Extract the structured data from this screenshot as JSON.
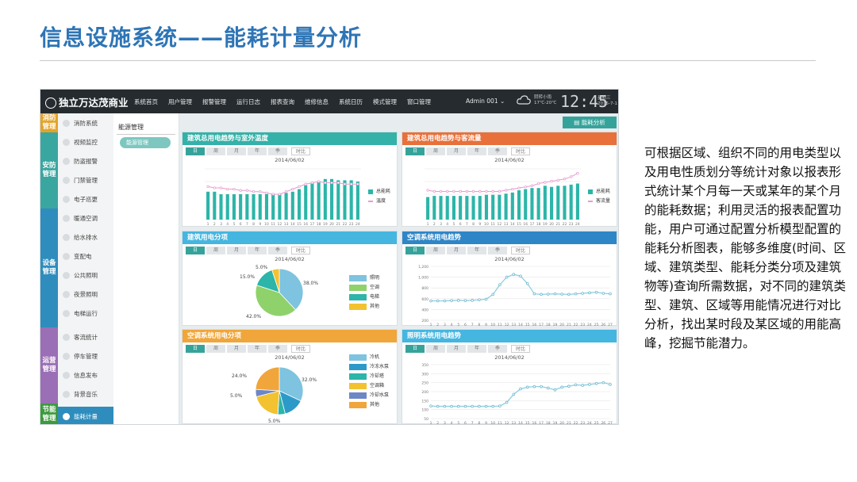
{
  "slide": {
    "title": "信息设施系统——能耗计量分析",
    "description": "可根据区域、组织不同的用电类型以及用电性质划分等统计对象以报表形式统计某个月每一天或某年的某个月的能耗数据；利用灵活的报表配置功能，用户可通过配置分析模型配置的能耗分析图表，能够多维度(时间、区域、建筑类型、能耗分类分项及建筑物等)查询所需数据，对不同的建筑类型、建筑、区域等用能情况进行对比分析，找出某时段及某区域的用能高峰，挖掘节能潜力。"
  },
  "app": {
    "logo_text": "独立万达茂商业",
    "nav": [
      "系统首页",
      "用户管理",
      "报警管理",
      "运行日志",
      "报表查询",
      "维修信息",
      "系统日历",
      "模式管理",
      "窗口管理"
    ],
    "admin": "Admin 001",
    "weather": [
      "阴转小雨",
      "17℃-20℃"
    ],
    "clock": "12:45",
    "date": [
      "星期三",
      "2015-7-1"
    ],
    "top_button": "能耗分析",
    "sub_title": "能源管理",
    "sub_item": "能源管理",
    "groups": [
      {
        "label": "消防管理",
        "color": "#e3a32a"
      },
      {
        "label": "安防管理",
        "color": "#3aa6a0"
      },
      {
        "label": "设备管理",
        "color": "#2f8dbd"
      },
      {
        "label": "运营管理",
        "color": "#9b6fb5"
      },
      {
        "label": "节能管理",
        "color": "#3d9a3d"
      }
    ],
    "menu": [
      "消防系统",
      "视频监控",
      "防盗报警",
      "门禁管理",
      "电子巡更",
      "暖通空调",
      "给水排水",
      "变配电",
      "公共照明",
      "夜景照明",
      "电梯运行",
      "客流统计",
      "停车管理",
      "信息发布",
      "背景音乐",
      "能耗计量"
    ]
  },
  "tabs": [
    "日",
    "周",
    "月",
    "年",
    "季",
    "时比"
  ],
  "panels": [
    {
      "title": "建筑总用电趋势与室外温度",
      "color": "#34b1a8",
      "date": "2014/06/02",
      "legend": [
        "总能耗",
        "温度"
      ],
      "series_colors": [
        "#2cb5a8",
        "#e89ad0"
      ]
    },
    {
      "title": "建筑总用电趋势与客流量",
      "color": "#e8703a",
      "date": "2014/06/02",
      "legend": [
        "总能耗",
        "客流量"
      ],
      "series_colors": [
        "#2cb5a8",
        "#e89ad0"
      ]
    },
    {
      "title": "建筑用电分项",
      "color": "#45b6e0",
      "date": "2014/06/02",
      "legend": [
        "照明",
        "空调",
        "电梯",
        "其他"
      ]
    },
    {
      "title": "空调系统用电趋势",
      "color": "#2f86c7",
      "date": "2014/06/02"
    },
    {
      "title": "空调系统用电分项",
      "color": "#f0a63a",
      "date": "2014/06/02",
      "legend": [
        "冷机",
        "冷冻水泵",
        "冷却塔",
        "空调箱",
        "冷却水泵",
        "其他"
      ]
    },
    {
      "title": "照明系统用电趋势",
      "color": "#45b6e0",
      "date": "2014/06/02"
    }
  ],
  "chart_data": [
    {
      "type": "bar",
      "title": "建筑总用电趋势与室外温度",
      "categories": [
        "1",
        "2",
        "3",
        "4",
        "5",
        "6",
        "7",
        "8",
        "9",
        "10",
        "11",
        "12",
        "13",
        "14",
        "15",
        "16",
        "17",
        "18",
        "19",
        "20",
        "21",
        "22",
        "23",
        "24"
      ],
      "series": [
        {
          "name": "总能耗",
          "values": [
            22,
            22,
            20,
            20,
            20,
            20,
            20,
            20,
            20,
            20,
            20,
            20,
            21,
            22,
            24,
            27,
            29,
            30,
            32,
            32,
            31,
            31,
            31,
            30
          ]
        },
        {
          "name": "温度",
          "values": [
            26,
            25,
            25,
            24,
            24,
            23,
            23,
            22,
            22,
            21,
            20,
            20,
            22,
            24,
            26,
            28,
            29,
            30,
            29,
            29,
            29,
            28,
            28,
            28
          ]
        }
      ],
      "ylim": [
        0,
        40
      ]
    },
    {
      "type": "bar",
      "title": "建筑总用电趋势与客流量",
      "categories": [
        "1",
        "2",
        "3",
        "4",
        "5",
        "6",
        "7",
        "8",
        "9",
        "10",
        "11",
        "12",
        "13",
        "14",
        "15",
        "16",
        "17",
        "18",
        "19",
        "20",
        "21",
        "22",
        "23",
        "24"
      ],
      "series": [
        {
          "name": "总能耗",
          "values": [
            20,
            21,
            21,
            21,
            21,
            21,
            21,
            21,
            21,
            22,
            22,
            22,
            23,
            24,
            26,
            27,
            28,
            28,
            30,
            29,
            30,
            30,
            31,
            32
          ]
        },
        {
          "name": "客流量",
          "values": [
            26,
            25,
            25,
            25,
            25,
            25,
            25,
            25,
            25,
            25,
            25,
            25,
            26,
            27,
            28,
            29,
            30,
            32,
            33,
            34,
            35,
            36,
            38,
            41
          ]
        }
      ],
      "ylim": [
        0,
        45
      ]
    },
    {
      "type": "pie",
      "title": "建筑用电分项",
      "labels": [
        "照明",
        "空调",
        "电梯",
        "其他"
      ],
      "values": [
        38.0,
        42.0,
        15.0,
        5.0
      ],
      "label_text": [
        "38.0%",
        "42.0%",
        "15.0%",
        "5.0%"
      ]
    },
    {
      "type": "line",
      "title": "空调系统用电趋势",
      "x": [
        1,
        2,
        3,
        4,
        5,
        6,
        7,
        8,
        9,
        10,
        11,
        12,
        13,
        14,
        15,
        16,
        17,
        18,
        19,
        20,
        21,
        22,
        23,
        24,
        25,
        26,
        27
      ],
      "y": [
        560,
        560,
        560,
        565,
        570,
        565,
        570,
        580,
        590,
        680,
        860,
        1000,
        1050,
        1020,
        880,
        690,
        680,
        685,
        690,
        685,
        680,
        690,
        700,
        710,
        720,
        700,
        690
      ],
      "yticks": [
        "1,200",
        "1,000",
        "800",
        "600",
        "400",
        "200"
      ],
      "ylim": [
        200,
        1200
      ]
    },
    {
      "type": "pie",
      "title": "空调系统用电分项",
      "labels": [
        "冷机",
        "冷冻水泵",
        "冷却塔",
        "空调箱",
        "冷却水泵",
        "其他"
      ],
      "values": [
        32.0,
        14.0,
        5.0,
        20.0,
        5.0,
        24.0
      ],
      "label_text": [
        "32.0%",
        "5.0%",
        "5.0%",
        "24.0%"
      ]
    },
    {
      "type": "line",
      "title": "照明系统用电趋势",
      "x": [
        1,
        2,
        3,
        4,
        5,
        6,
        7,
        8,
        9,
        10,
        11,
        12,
        13,
        14,
        15,
        16,
        17,
        18,
        19,
        20,
        21,
        22,
        23,
        24,
        25,
        26,
        27
      ],
      "y": [
        120,
        118,
        118,
        118,
        118,
        118,
        118,
        118,
        118,
        118,
        120,
        140,
        185,
        215,
        225,
        228,
        228,
        220,
        210,
        225,
        230,
        238,
        235,
        240,
        245,
        250,
        240
      ],
      "yticks": [
        "350",
        "300",
        "250",
        "200",
        "150",
        "100",
        "50"
      ],
      "ylim": [
        50,
        350
      ]
    }
  ]
}
